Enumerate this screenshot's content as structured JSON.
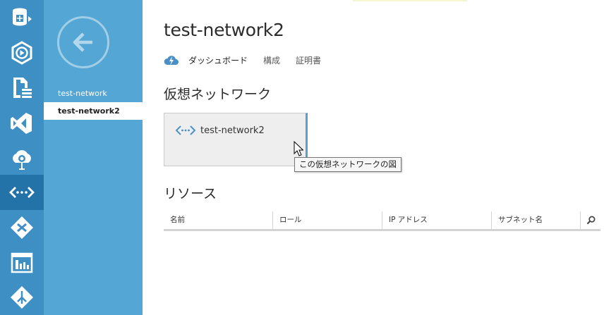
{
  "nav_rail": {
    "items": [
      {
        "icon": "sql-database-icon",
        "active": false
      },
      {
        "icon": "media-services-icon",
        "active": false
      },
      {
        "icon": "storage-icon",
        "active": false
      },
      {
        "icon": "visual-studio-icon",
        "active": false
      },
      {
        "icon": "hdinsight-icon",
        "active": false
      },
      {
        "icon": "virtual-network-icon",
        "active": true
      },
      {
        "icon": "traffic-manager-icon",
        "active": false
      },
      {
        "icon": "management-services-icon",
        "active": false
      },
      {
        "icon": "service-bus-icon",
        "active": false
      }
    ]
  },
  "subnav": {
    "back_icon": "back-arrow-icon",
    "items": [
      {
        "label": "test-network",
        "selected": false
      },
      {
        "label": "test-network2",
        "selected": true
      }
    ]
  },
  "page": {
    "title": "test-network2",
    "tabs": [
      {
        "label": "ダッシュボード",
        "active": true
      },
      {
        "label": "構成",
        "active": false
      },
      {
        "label": "証明書",
        "active": false
      }
    ]
  },
  "virtual_network_section": {
    "title": "仮想ネットワーク",
    "tile_label": "test-network2",
    "tooltip": "この仮想ネットワークの図"
  },
  "resources_section": {
    "title": "リソース",
    "columns": [
      "名前",
      "ロール",
      "IP アドレス",
      "サブネット名"
    ],
    "search_icon": "search-icon"
  },
  "colors": {
    "rail": "#3d8fc4",
    "rail_active": "#2373a8",
    "subnav": "#54a6d4",
    "accent": "#5c9fcf"
  }
}
